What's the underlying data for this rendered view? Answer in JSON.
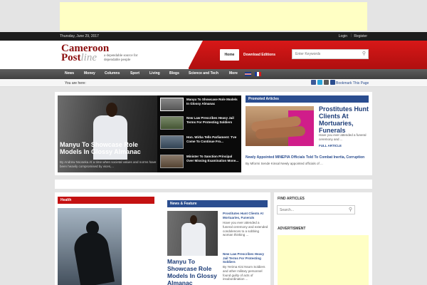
{
  "topbar": {
    "date": "Thursday, June 29, 2017",
    "login": "Login",
    "separator": "|",
    "register": "Register"
  },
  "header": {
    "logo_line1": "Cameroon",
    "logo_line2_a": "Post",
    "logo_line2_b": "line",
    "tagline": "a dependable source for dependable people",
    "home_label": "Home",
    "download_label": "Download Editions",
    "search_placeholder": "Enter Keywords"
  },
  "menu": [
    "News",
    "Money",
    "Columns",
    "Sport",
    "Living",
    "Blogs",
    "Science and Tech",
    "More"
  ],
  "breadcrumb": {
    "label": "You are here:",
    "bookmark": "Bookmark This Page"
  },
  "slider": {
    "title": "Manyu To Showcase Role Models In Glossy Almanac",
    "desc": "By Andrew Nsoseka At a time when societal values and norms have been heavily compromised by vices,...",
    "thumbs": [
      "Manyu To Showcase Role Models In Glossy Almanac",
      "New Law Prescribes Heavy Jail Terms For Protesting Soldiers",
      "Hon. Wirba Tells Parliament: 'I've Come To Continue Fro...",
      "Minister To Sanction Principal Over Missing Examination Mone..."
    ]
  },
  "promoted": {
    "header": "Promoted Articles",
    "title": "Prostitutes Hunt Clients At Mortuaries, Funerals",
    "desc": "Have you ever attended a funeral ceremony and ...",
    "full_article": "FULL ARTICLE",
    "link_title": "Newly Appointed MINEPIA Officials Told To Combat Inertia, Corruption",
    "link_desc": "By Mformi Sende Kinsal Newly appointed officials of ..."
  },
  "health": {
    "header": "Health"
  },
  "news_feature": {
    "header": "News & Feature",
    "title": "Manyu To Showcase Role Models In Glossy Almanac",
    "items": [
      {
        "title": "Prostitutes Hunt Clients At Mortuaries, Funerals",
        "desc": "Have you ever attended a funeral ceremony and extended condolences to a sobbing woman thinking ..."
      },
      {
        "title": "New Law Prescribes Heavy Jail Terms For Protesting Soldiers",
        "desc": "By Yerima Kini Nsom Soldiers and other military personnel found guilty of acts of insubordination ..."
      }
    ]
  },
  "sidebar": {
    "find_header": "FIND ARTICLES",
    "search_placeholder": "Search...",
    "ad_header": "ADVERTISMENT"
  },
  "colors": {
    "red": "#c41111",
    "blue": "#2a4d8f",
    "dark": "#1d1d1d"
  }
}
